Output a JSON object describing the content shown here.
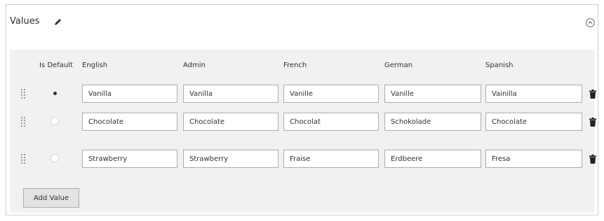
{
  "panel": {
    "title": "Values",
    "edit_icon": "pencil-icon",
    "collapse_icon": "circle-chevron-up-icon"
  },
  "columns": {
    "is_default": "Is Default",
    "english": "English",
    "admin": "Admin",
    "french": "French",
    "german": "German",
    "spanish": "Spanish"
  },
  "rows": [
    {
      "default": true,
      "english": "Vanilla",
      "admin": "Vanilla",
      "french": "Vanille",
      "german": "Vanille",
      "spanish": "Vainilla"
    },
    {
      "default": false,
      "english": "Chocolate",
      "admin": "Chocolate",
      "french": "Chocolat",
      "german": "Schokolade",
      "spanish": "Chocolate"
    },
    {
      "default": false,
      "english": "Strawberry",
      "admin": "Strawberry",
      "french": "Fraise",
      "german": "Erdbeere",
      "spanish": "Fresa"
    }
  ],
  "actions": {
    "add_value_label": "Add Value",
    "delete_icon": "trash-icon",
    "drag_icon": "drag-handle-icon"
  }
}
